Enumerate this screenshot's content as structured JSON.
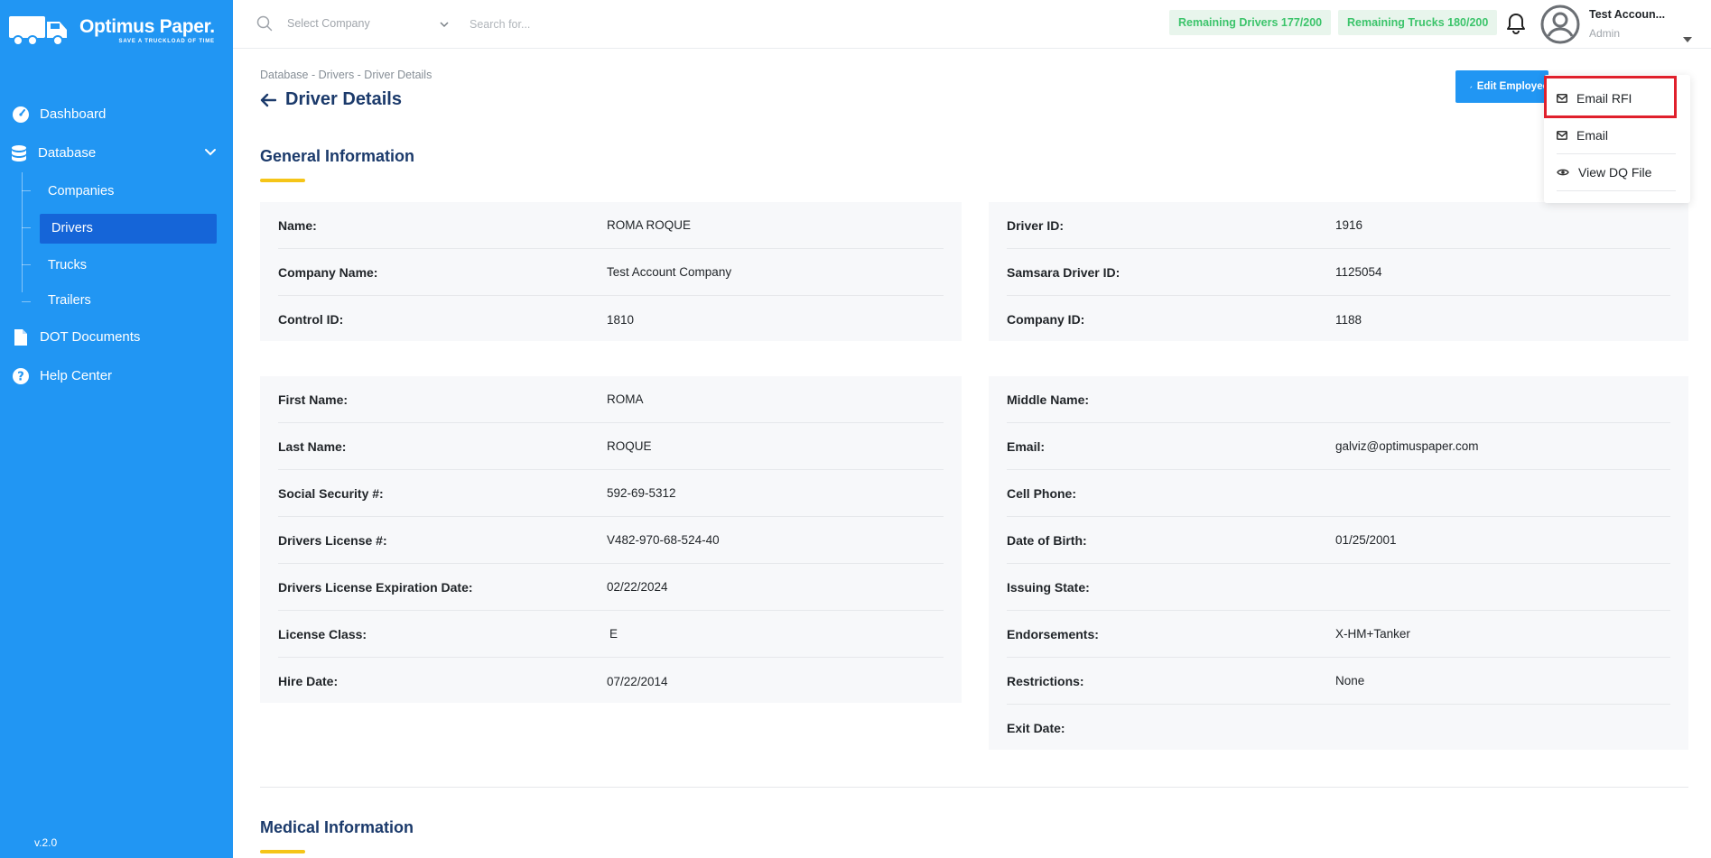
{
  "sidebar": {
    "logo_title": "Optimus Paper.",
    "logo_tagline": "SAVE A TRUCKLOAD OF TIME",
    "items": {
      "dashboard": "Dashboard",
      "database": "Database",
      "companies": "Companies",
      "drivers": "Drivers",
      "trucks": "Trucks",
      "trailers": "Trailers",
      "dot_documents": "DOT Documents",
      "help_center": "Help Center"
    },
    "version": "v.2.0"
  },
  "header": {
    "select_company_placeholder": "Select Company",
    "search_placeholder": "Search for...",
    "remaining_drivers": "Remaining Drivers 177/200",
    "remaining_trucks": "Remaining Trucks 180/200",
    "user_name": "Test Accoun...",
    "user_role": "Admin"
  },
  "page": {
    "breadcrumb": "Database - Drivers - Driver Details",
    "title": "Driver Details",
    "edit_button": "Edit Employee"
  },
  "menu": {
    "email_rfi": "Email RFI",
    "email": "Email",
    "view_dq_file": "View DQ File"
  },
  "general": {
    "title": "General Information",
    "card1": [
      {
        "k": "Name:",
        "v": "ROMA ROQUE"
      },
      {
        "k": "Company Name:",
        "v": "Test Account Company"
      },
      {
        "k": "Control ID:",
        "v": "1810"
      }
    ],
    "card2": [
      {
        "k": "Driver ID:",
        "v": "1916"
      },
      {
        "k": "Samsara Driver ID:",
        "v": "1125054"
      },
      {
        "k": "Company ID:",
        "v": "1188"
      }
    ],
    "card3": [
      {
        "k": "First Name:",
        "v": "ROMA"
      },
      {
        "k": "Last Name:",
        "v": "ROQUE"
      },
      {
        "k": "Social Security #:",
        "v": "592-69-5312"
      },
      {
        "k": "Drivers License #:",
        "v": "V482-970-68-524-40"
      },
      {
        "k": "Drivers License Expiration Date:",
        "v": "02/22/2024"
      },
      {
        "k": "License Class:",
        "v": "E"
      },
      {
        "k": "Hire Date:",
        "v": "07/22/2014"
      }
    ],
    "card4": [
      {
        "k": "Middle Name:",
        "v": ""
      },
      {
        "k": "Email:",
        "v": "galviz@optimuspaper.com"
      },
      {
        "k": "Cell Phone:",
        "v": ""
      },
      {
        "k": "Date of Birth:",
        "v": "01/25/2001"
      },
      {
        "k": "Issuing State:",
        "v": ""
      },
      {
        "k": "Endorsements:",
        "v": "X-HM+Tanker"
      },
      {
        "k": "Restrictions:",
        "v": "None"
      },
      {
        "k": "Exit Date:",
        "v": ""
      }
    ]
  },
  "medical": {
    "title": "Medical Information"
  }
}
